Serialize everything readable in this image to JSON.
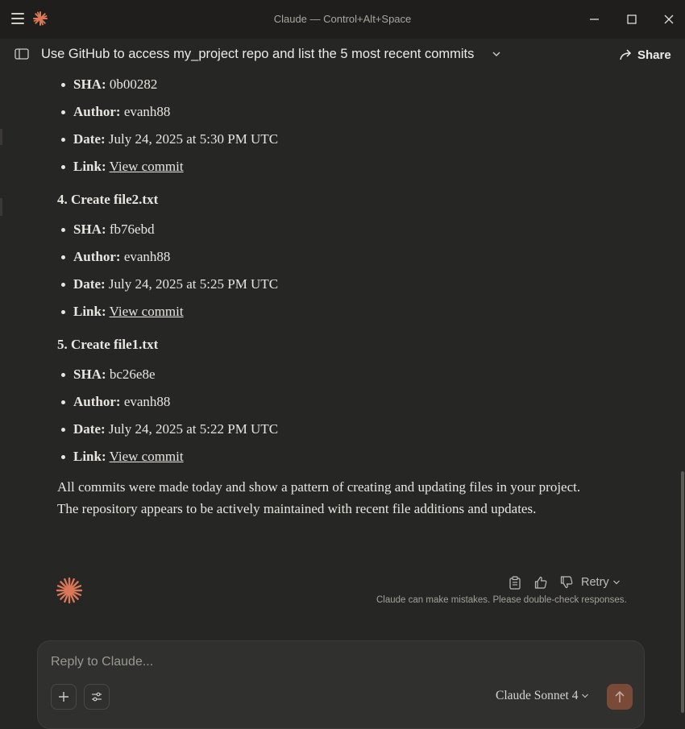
{
  "window": {
    "title": "Claude — Control+Alt+Space"
  },
  "header": {
    "conversation_title": "Use GitHub to access my_project repo and list the 5 most recent commits",
    "share_label": "Share"
  },
  "commits_partial": {
    "sha_label": "SHA:",
    "sha": "0b00282",
    "author_label": "Author:",
    "author": "evanh88",
    "date_label": "Date:",
    "date": "July 24, 2025 at 5:30 PM UTC",
    "link_label": "Link:",
    "link_text": "View commit"
  },
  "commits": [
    {
      "heading": "4. Create file2.txt",
      "sha_label": "SHA:",
      "sha": "fb76ebd",
      "author_label": "Author:",
      "author": "evanh88",
      "date_label": "Date:",
      "date": "July 24, 2025 at 5:25 PM UTC",
      "link_label": "Link:",
      "link_text": "View commit"
    },
    {
      "heading": "5. Create file1.txt",
      "sha_label": "SHA:",
      "sha": "bc26e8e",
      "author_label": "Author:",
      "author": "evanh88",
      "date_label": "Date:",
      "date": "July 24, 2025 at 5:22 PM UTC",
      "link_label": "Link:",
      "link_text": "View commit"
    }
  ],
  "summary": "All commits were made today and show a pattern of creating and updating files in your project. The repository appears to be actively maintained with recent file additions and updates.",
  "response_actions": {
    "retry_label": "Retry",
    "disclaimer": "Claude can make mistakes. Please double-check responses."
  },
  "composer": {
    "placeholder": "Reply to Claude...",
    "model_label": "Claude Sonnet 4"
  },
  "colors": {
    "background": "#262624",
    "titlebar": "#1f1e1d",
    "accent": "#d97757",
    "send_button": "#7a4a38"
  },
  "icons": [
    "menu-icon",
    "claude-logo-icon",
    "minimize-icon",
    "maximize-icon",
    "close-icon",
    "sidebar-toggle-icon",
    "chevron-down-icon",
    "share-icon",
    "copy-icon",
    "thumbs-up-icon",
    "thumbs-down-icon",
    "plus-icon",
    "settings-sliders-icon",
    "arrow-up-icon"
  ]
}
